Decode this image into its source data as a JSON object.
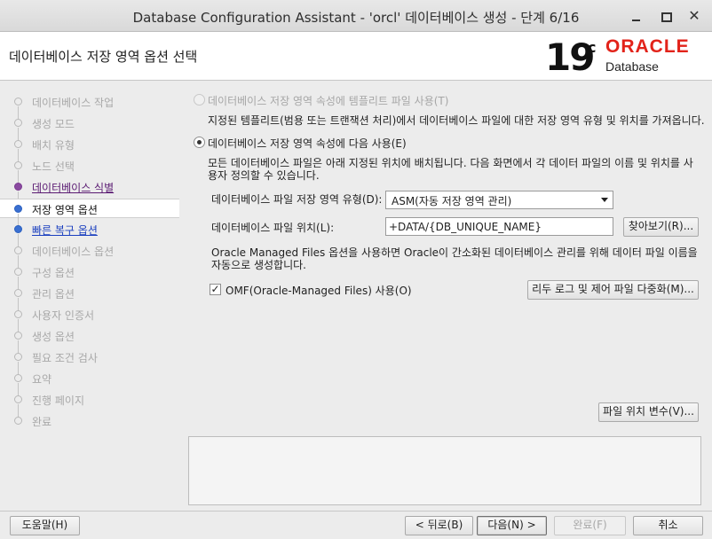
{
  "window": {
    "title": "Database Configuration Assistant - 'orcl' 데이터베이스 생성 - 단계 6/16",
    "close_glyph": "✕"
  },
  "header": {
    "title": "데이터베이스 저장 영역 옵션 선택",
    "logo_version": "19",
    "logo_suffix": "c",
    "logo_brand": "ORACLE",
    "logo_product": "Database"
  },
  "steps": [
    {
      "label": "데이터베이스 작업",
      "state": "disabled"
    },
    {
      "label": "생성 모드",
      "state": "disabled"
    },
    {
      "label": "배치 유형",
      "state": "disabled"
    },
    {
      "label": "노드 선택",
      "state": "disabled"
    },
    {
      "label": "데이터베이스 식별",
      "state": "visited"
    },
    {
      "label": "저장 영역 옵션",
      "state": "current"
    },
    {
      "label": "빠른 복구 옵션",
      "state": "next"
    },
    {
      "label": "데이터베이스 옵션",
      "state": "disabled"
    },
    {
      "label": "구성 옵션",
      "state": "disabled"
    },
    {
      "label": "관리 옵션",
      "state": "disabled"
    },
    {
      "label": "사용자 인증서",
      "state": "disabled"
    },
    {
      "label": "생성 옵션",
      "state": "disabled"
    },
    {
      "label": "필요 조건 검사",
      "state": "disabled"
    },
    {
      "label": "요약",
      "state": "disabled"
    },
    {
      "label": "진행 페이지",
      "state": "disabled"
    },
    {
      "label": "완료",
      "state": "disabled"
    }
  ],
  "options": {
    "template_radio_label": "데이터베이스 저장 영역 속성에 템플리트 파일 사용(T)",
    "template_desc": "지정된 템플리트(범용 또는 트랜잭션 처리)에서 데이터베이스 파일에 대한 저장 영역 유형 및 위치를 가져옵니다.",
    "custom_radio_label": "데이터베이스 저장 영역 속성에 다음 사용(E)",
    "custom_desc": "모든 데이터베이스 파일은 아래 지정된 위치에 배치됩니다. 다음 화면에서 각 데이터 파일의 이름 및 위치를 사용자 정의할 수 있습니다.",
    "storage_type_label": "데이터베이스 파일 저장 영역 유형(D):",
    "storage_type_value": "ASM(자동 저장 영역 관리)",
    "file_location_label": "데이터베이스 파일 위치(L):",
    "file_location_value": "+DATA/{DB_UNIQUE_NAME}",
    "browse_button": "찾아보기(R)...",
    "omf_desc": "Oracle Managed Files 옵션을 사용하면 Oracle이 간소화된 데이터베이스 관리를 위해 데이터 파일 이름을 자동으로 생성합니다.",
    "omf_checkbox_label": "OMF(Oracle-Managed Files) 사용(O)",
    "omf_checked": true,
    "multiplex_button": "리두 로그 및 제어 파일 다중화(M)...",
    "file_vars_button": "파일 위치 변수(V)..."
  },
  "footer": {
    "help": "도움말(H)",
    "back": "< 뒤로(B)",
    "next": "다음(N) >",
    "finish": "완료(F)",
    "cancel": "취소"
  }
}
